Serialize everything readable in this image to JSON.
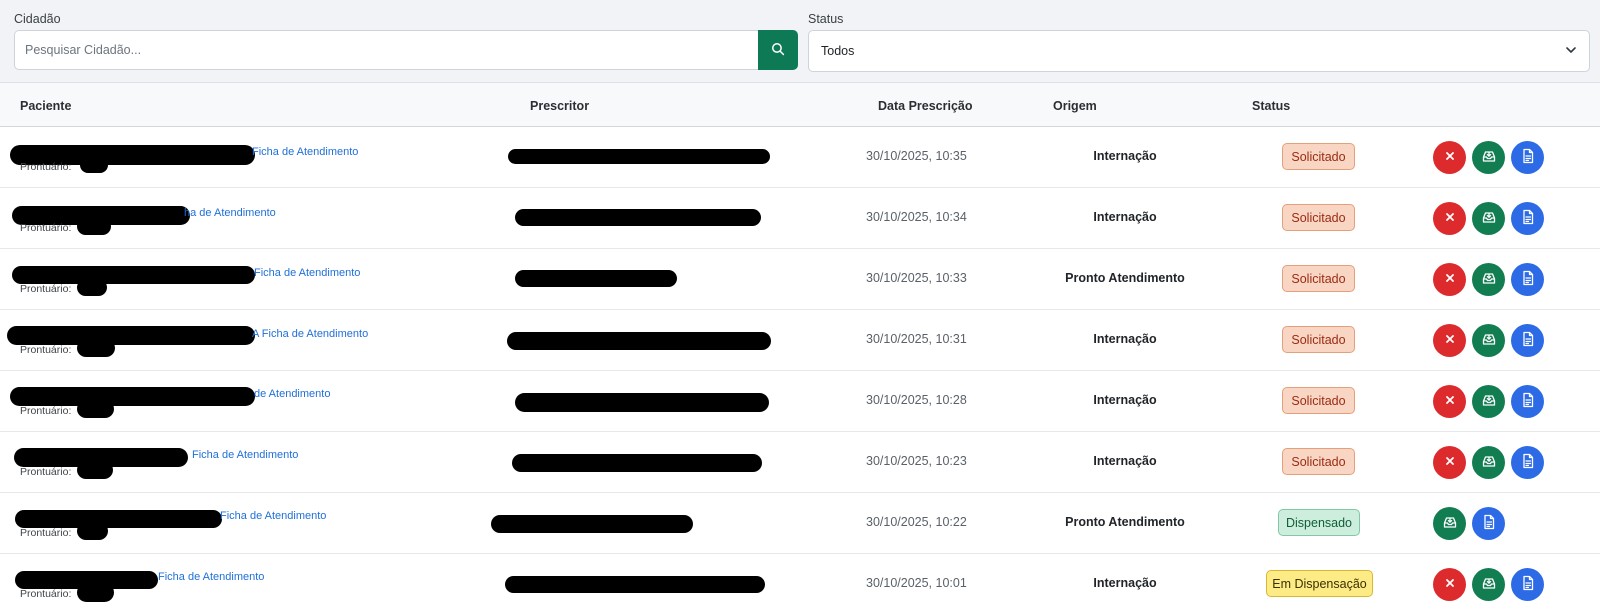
{
  "filters": {
    "cidadao_label": "Cidadão",
    "search_placeholder": "Pesquisar Cidadão...",
    "status_label": "Status",
    "status_value": "Todos"
  },
  "table": {
    "columns": [
      "Paciente",
      "Prescritor",
      "Data Prescrição",
      "Origem",
      "Status"
    ],
    "prontuario_label": "Prontuário:",
    "rows": [
      {
        "link": "Ficha de Atendimento",
        "date": "30/10/2025, 10:35",
        "origin": "Internação",
        "status": "Solicitado"
      },
      {
        "link": "ha de Atendimento",
        "date": "30/10/2025, 10:34",
        "origin": "Internação",
        "status": "Solicitado"
      },
      {
        "link": "Ficha de Atendimento",
        "date": "30/10/2025, 10:33",
        "origin": "Pronto Atendimento",
        "status": "Solicitado"
      },
      {
        "link": "A Ficha de Atendimento",
        "date": "30/10/2025, 10:31",
        "origin": "Internação",
        "status": "Solicitado"
      },
      {
        "link": "de Atendimento",
        "date": "30/10/2025, 10:28",
        "origin": "Internação",
        "status": "Solicitado"
      },
      {
        "link": "Ficha de Atendimento",
        "date": "30/10/2025, 10:23",
        "origin": "Internação",
        "status": "Solicitado"
      },
      {
        "link": "Ficha de Atendimento",
        "date": "30/10/2025, 10:22",
        "origin": "Pronto Atendimento",
        "status": "Dispensado"
      },
      {
        "link": "Ficha de Atendimento",
        "date": "30/10/2025, 10:01",
        "origin": "Internação",
        "status": "Em Dispensação"
      }
    ]
  },
  "colors": {
    "primary_green": "#0d7a55",
    "danger_red": "#dc2a2d",
    "info_blue": "#2d6be6",
    "link_blue": "#1f6fd9"
  },
  "icons": {
    "search": "search-icon",
    "dropdown": "chevron-down-icon",
    "cancel": "close-icon",
    "dispense": "inbox-download-icon",
    "document": "document-icon"
  }
}
